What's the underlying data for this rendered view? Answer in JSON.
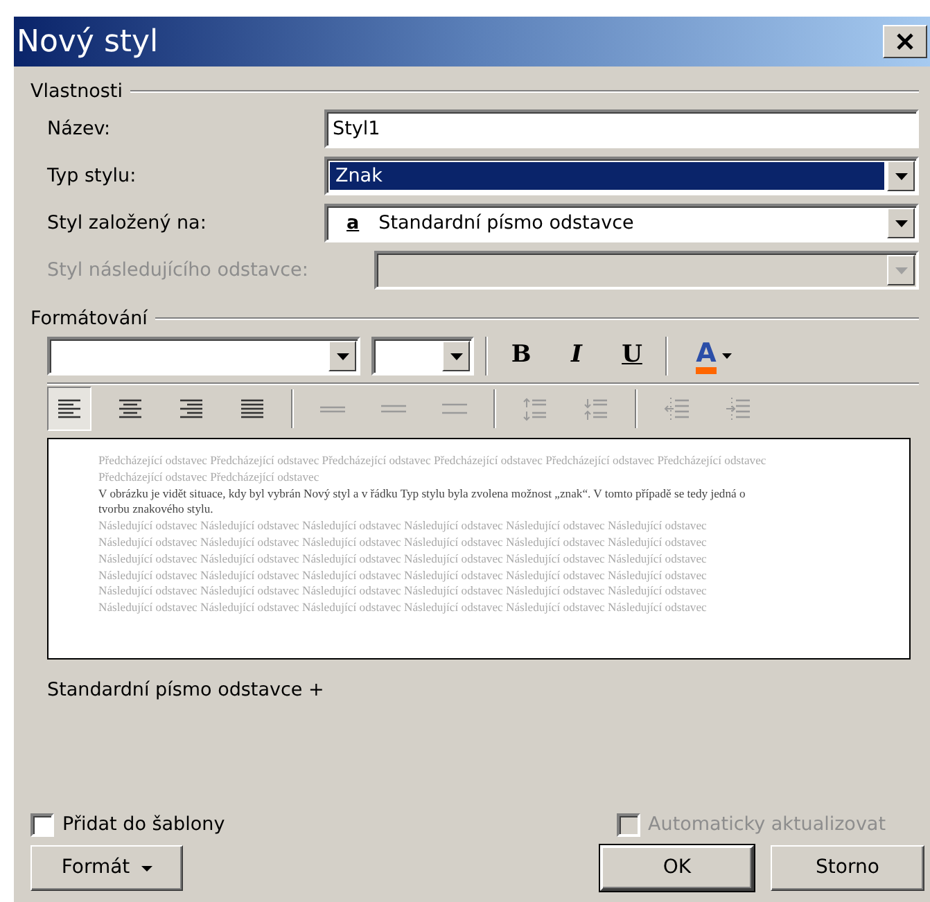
{
  "window": {
    "title": "Nový styl"
  },
  "properties": {
    "legend": "Vlastnosti",
    "fields": [
      {
        "label": "Název:",
        "kind": "text",
        "value": "Styl1",
        "disabled": false,
        "highlighted": false
      },
      {
        "label": "Typ stylu:",
        "kind": "select",
        "value": "Znak",
        "disabled": false,
        "highlighted": true
      },
      {
        "label": "Styl založený na:",
        "kind": "select",
        "glyph": "a",
        "value": "Standardní písmo odstavce",
        "disabled": false,
        "highlighted": false
      },
      {
        "label": "Styl následujícího odstavce:",
        "kind": "select",
        "disabled": true,
        "highlighted": false
      }
    ]
  },
  "formatting": {
    "legend": "Formátování",
    "font_buttons": [
      {
        "kind": "bold",
        "glyph": "B"
      },
      {
        "kind": "italic",
        "glyph": "I"
      },
      {
        "kind": "underline",
        "glyph": "U"
      }
    ],
    "font_color": {
      "glyph": "A",
      "color": "#ff6600"
    },
    "paragraph_tools": [
      [
        {
          "kind": "align-left",
          "pressed": true,
          "disabled": false
        },
        {
          "kind": "align-center",
          "pressed": false,
          "disabled": false
        },
        {
          "kind": "align-right",
          "pressed": false,
          "disabled": false
        },
        {
          "kind": "justify",
          "pressed": false,
          "disabled": false
        }
      ],
      [
        {
          "kind": "spacing-single",
          "pressed": false,
          "disabled": true
        },
        {
          "kind": "spacing-onehalf",
          "pressed": false,
          "disabled": true
        },
        {
          "kind": "spacing-double",
          "pressed": false,
          "disabled": true
        }
      ],
      [
        {
          "kind": "space-before",
          "pressed": false,
          "disabled": true
        },
        {
          "kind": "space-after",
          "pressed": false,
          "disabled": true
        }
      ],
      [
        {
          "kind": "indent-decrease",
          "pressed": false,
          "disabled": true
        },
        {
          "kind": "indent-increase",
          "pressed": false,
          "disabled": true
        }
      ]
    ],
    "preview": {
      "preceding": "Předcházející odstavec Předcházející odstavec Předcházející odstavec Předcházející odstavec Předcházející odstavec Předcházející odstavec Předcházející odstavec Předcházející odstavec",
      "sample": "V obrázku je vidět situace, kdy byl vybrán Nový styl a v řádku Typ stylu byla zvolena možnost „znak“. V tomto případě se tedy jedná o tvorbu znakového stylu.",
      "following": "Následující odstavec Následující odstavec Následující odstavec Následující odstavec Následující odstavec Následující odstavec Následující odstavec Následující odstavec Následující odstavec Následující odstavec Následující odstavec Následující odstavec Následující odstavec Následující odstavec Následující odstavec Následující odstavec Následující odstavec Následující odstavec Následující odstavec Následující odstavec Následující odstavec Následující odstavec Následující odstavec Následující odstavec Následující odstavec Následující odstavec Následující odstavec Následující odstavec Následující odstavec Následující odstavec Následující odstavec Následující odstavec Následující odstavec Následující odstavec Následující odstavec Následující odstavec"
    },
    "description": "Standardní písmo odstavce +"
  },
  "checkboxes": [
    {
      "label": "Přidat do šablony",
      "checked": false,
      "disabled": false
    },
    {
      "label": "Automaticky aktualizovat",
      "checked": false,
      "disabled": true
    }
  ],
  "buttons": [
    {
      "label": "Formát",
      "kind": "menu",
      "default": false
    },
    {
      "label": "OK",
      "kind": "plain",
      "default": true
    },
    {
      "label": "Storno",
      "kind": "plain",
      "default": false
    }
  ]
}
